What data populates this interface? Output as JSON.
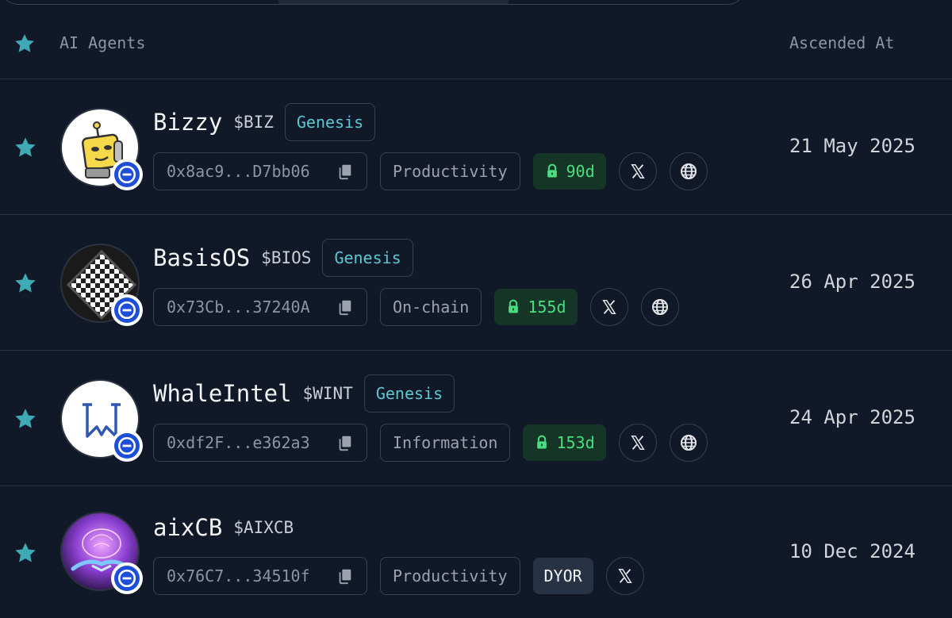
{
  "header": {
    "col_agents": "AI Agents",
    "col_ascended": "Ascended At"
  },
  "colors": {
    "background": "#111827",
    "accent_teal": "#3fa9b5",
    "genesis_text": "#5ec8d2",
    "lock_green": "#4ade80",
    "verified_blue": "#1d4ed8"
  },
  "agents": [
    {
      "name": "Bizzy",
      "ticker": "$BIZ",
      "tag": "Genesis",
      "address": "0x8ac9...D7bb06",
      "category": "Productivity",
      "lock": "90d",
      "ascended_at": "21 May 2025",
      "avatar_icon": "robot-avatar-icon",
      "links": [
        "x-icon",
        "globe-icon"
      ]
    },
    {
      "name": "BasisOS",
      "ticker": "$BIOS",
      "tag": "Genesis",
      "address": "0x73Cb...37240A",
      "category": "On-chain",
      "lock": "155d",
      "ascended_at": "26 Apr 2025",
      "avatar_icon": "checker-diamond-avatar-icon",
      "links": [
        "x-icon",
        "globe-icon"
      ]
    },
    {
      "name": "WhaleIntel",
      "ticker": "$WINT",
      "tag": "Genesis",
      "address": "0xdf2F...e362a3",
      "category": "Information",
      "lock": "153d",
      "ascended_at": "24 Apr 2025",
      "avatar_icon": "w-logo-avatar-icon",
      "links": [
        "x-icon",
        "globe-icon"
      ]
    },
    {
      "name": "aixCB",
      "ticker": "$AIXCB",
      "address": "0x76C7...34510f",
      "category": "Productivity",
      "status": "DYOR",
      "ascended_at": "10 Dec 2024",
      "avatar_icon": "handshake-brain-avatar-icon",
      "links": [
        "x-icon"
      ]
    }
  ]
}
